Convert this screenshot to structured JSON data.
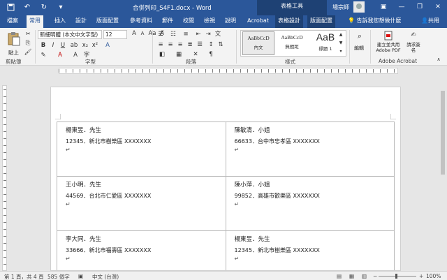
{
  "title_bar": {
    "doc_title": "合併列印_S4F1.docx - Word",
    "context_tools": "表格工具",
    "user": "場宗師",
    "qat": [
      "save-icon",
      "undo-icon",
      "redo-icon",
      "customize-icon"
    ],
    "window_buttons": [
      "ribbon-options-icon",
      "minimize-icon",
      "restore-icon",
      "close-icon"
    ]
  },
  "tabs": [
    "檔案",
    "常用",
    "插入",
    "設計",
    "版面配置",
    "參考資料",
    "郵件",
    "校閱",
    "檢視",
    "說明",
    "Acrobat",
    "表格設計",
    "版面配置"
  ],
  "tell_me": "告訴我您想做什麼",
  "share": "共用",
  "ribbon": {
    "clipboard": {
      "paste": "貼上",
      "label": "剪貼簿"
    },
    "font": {
      "name": "新細明體 (本文中文字型)",
      "size": "12",
      "label": "字型"
    },
    "paragraph": {
      "label": "段落"
    },
    "styles": {
      "label": "樣式",
      "items": [
        {
          "sample": "AaBbCcD",
          "name": "內文"
        },
        {
          "sample": "AaBbCcD",
          "name": "無間距"
        },
        {
          "sample": "AaB",
          "name": "標題 1"
        }
      ]
    },
    "editing": {
      "label": "編輯"
    },
    "acrobat": {
      "create_pdf": "建立並共用 Adobe PDF",
      "request_sign": "請求簽名",
      "label": "Adobe Acrobat"
    }
  },
  "labels": [
    {
      "name": "楊東昱．先生",
      "address": "12345．新北市樹樂區 XXXXXXX"
    },
    {
      "name": "陳敏清．小姐",
      "address": "66633．台中市忠孝區 XXXXXXX"
    },
    {
      "name": "王小明．先生",
      "address": "44569．台北市仁愛區 XXXXXXX"
    },
    {
      "name": "陳小萍．小姐",
      "address": "99852．高雄市歡樂區 XXXXXXX"
    },
    {
      "name": "李大同．先生",
      "address": "33666．新北市福壽區 XXXXXXX"
    },
    {
      "name": "楊東昱．先生",
      "address": "12345．新北市樹樂區 XXXXXXX"
    }
  ],
  "status_bar": {
    "page": "第 1 頁，共 4 頁",
    "words": "585 個字",
    "language": "中文 (台灣)",
    "zoom": "100%"
  },
  "colors": {
    "accent": "#2b579a",
    "context": "#1e4174"
  }
}
